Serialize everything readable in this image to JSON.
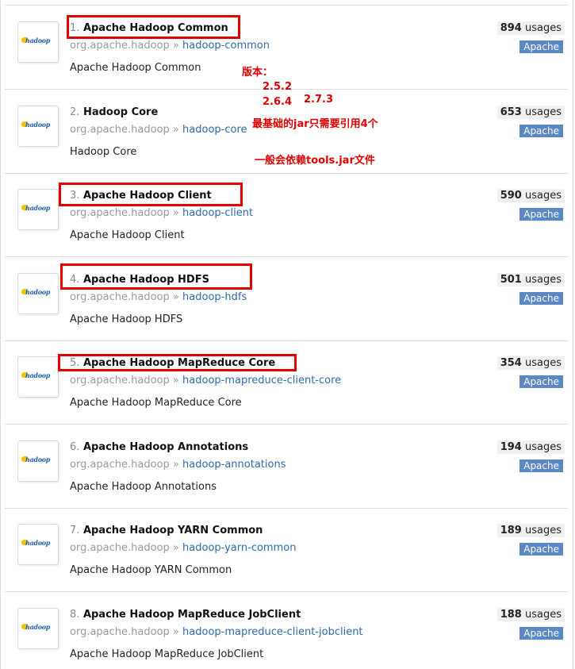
{
  "items": [
    {
      "num": "1.",
      "name": "Apache Hadoop Common",
      "group": "org.apache.hadoop",
      "artifact": "hadoop-common",
      "description": "Apache Hadoop Common",
      "count": "894",
      "usages": "usages",
      "tag": "Apache"
    },
    {
      "num": "2.",
      "name": "Hadoop Core",
      "group": "org.apache.hadoop",
      "artifact": "hadoop-core",
      "description": "Hadoop Core",
      "count": "653",
      "usages": "usages",
      "tag": "Apache"
    },
    {
      "num": "3.",
      "name": "Apache Hadoop Client",
      "group": "org.apache.hadoop",
      "artifact": "hadoop-client",
      "description": "Apache Hadoop Client",
      "count": "590",
      "usages": "usages",
      "tag": "Apache"
    },
    {
      "num": "4.",
      "name": "Apache Hadoop HDFS",
      "group": "org.apache.hadoop",
      "artifact": "hadoop-hdfs",
      "description": "Apache Hadoop HDFS",
      "count": "501",
      "usages": "usages",
      "tag": "Apache"
    },
    {
      "num": "5.",
      "name": "Apache Hadoop MapReduce Core",
      "group": "org.apache.hadoop",
      "artifact": "hadoop-mapreduce-client-core",
      "description": "Apache Hadoop MapReduce Core",
      "count": "354",
      "usages": "usages",
      "tag": "Apache"
    },
    {
      "num": "6.",
      "name": "Apache Hadoop Annotations",
      "group": "org.apache.hadoop",
      "artifact": "hadoop-annotations",
      "description": "Apache Hadoop Annotations",
      "count": "194",
      "usages": "usages",
      "tag": "Apache"
    },
    {
      "num": "7.",
      "name": "Apache Hadoop YARN Common",
      "group": "org.apache.hadoop",
      "artifact": "hadoop-yarn-common",
      "description": "Apache Hadoop YARN Common",
      "count": "189",
      "usages": "usages",
      "tag": "Apache"
    },
    {
      "num": "8.",
      "name": "Apache Hadoop MapReduce JobClient",
      "group": "org.apache.hadoop",
      "artifact": "hadoop-mapreduce-client-jobclient",
      "description": "Apache Hadoop MapReduce JobClient",
      "count": "188",
      "usages": "usages",
      "tag": "Apache"
    }
  ],
  "separator": "»",
  "logo_text": "hadoop",
  "annotations": {
    "version_label": "版本：",
    "v1": "2.5.2",
    "v2": "2.6.4",
    "v3": "2.7.3",
    "note1": "最基础的jar只需要引用4个",
    "note2": "一般会依赖tools.jar文件"
  },
  "colors": {
    "highlight_box": "#e30000",
    "annotation_text": "#e00000",
    "tag_bg": "#5b87c2",
    "artifact_link": "#2f6aa8"
  }
}
